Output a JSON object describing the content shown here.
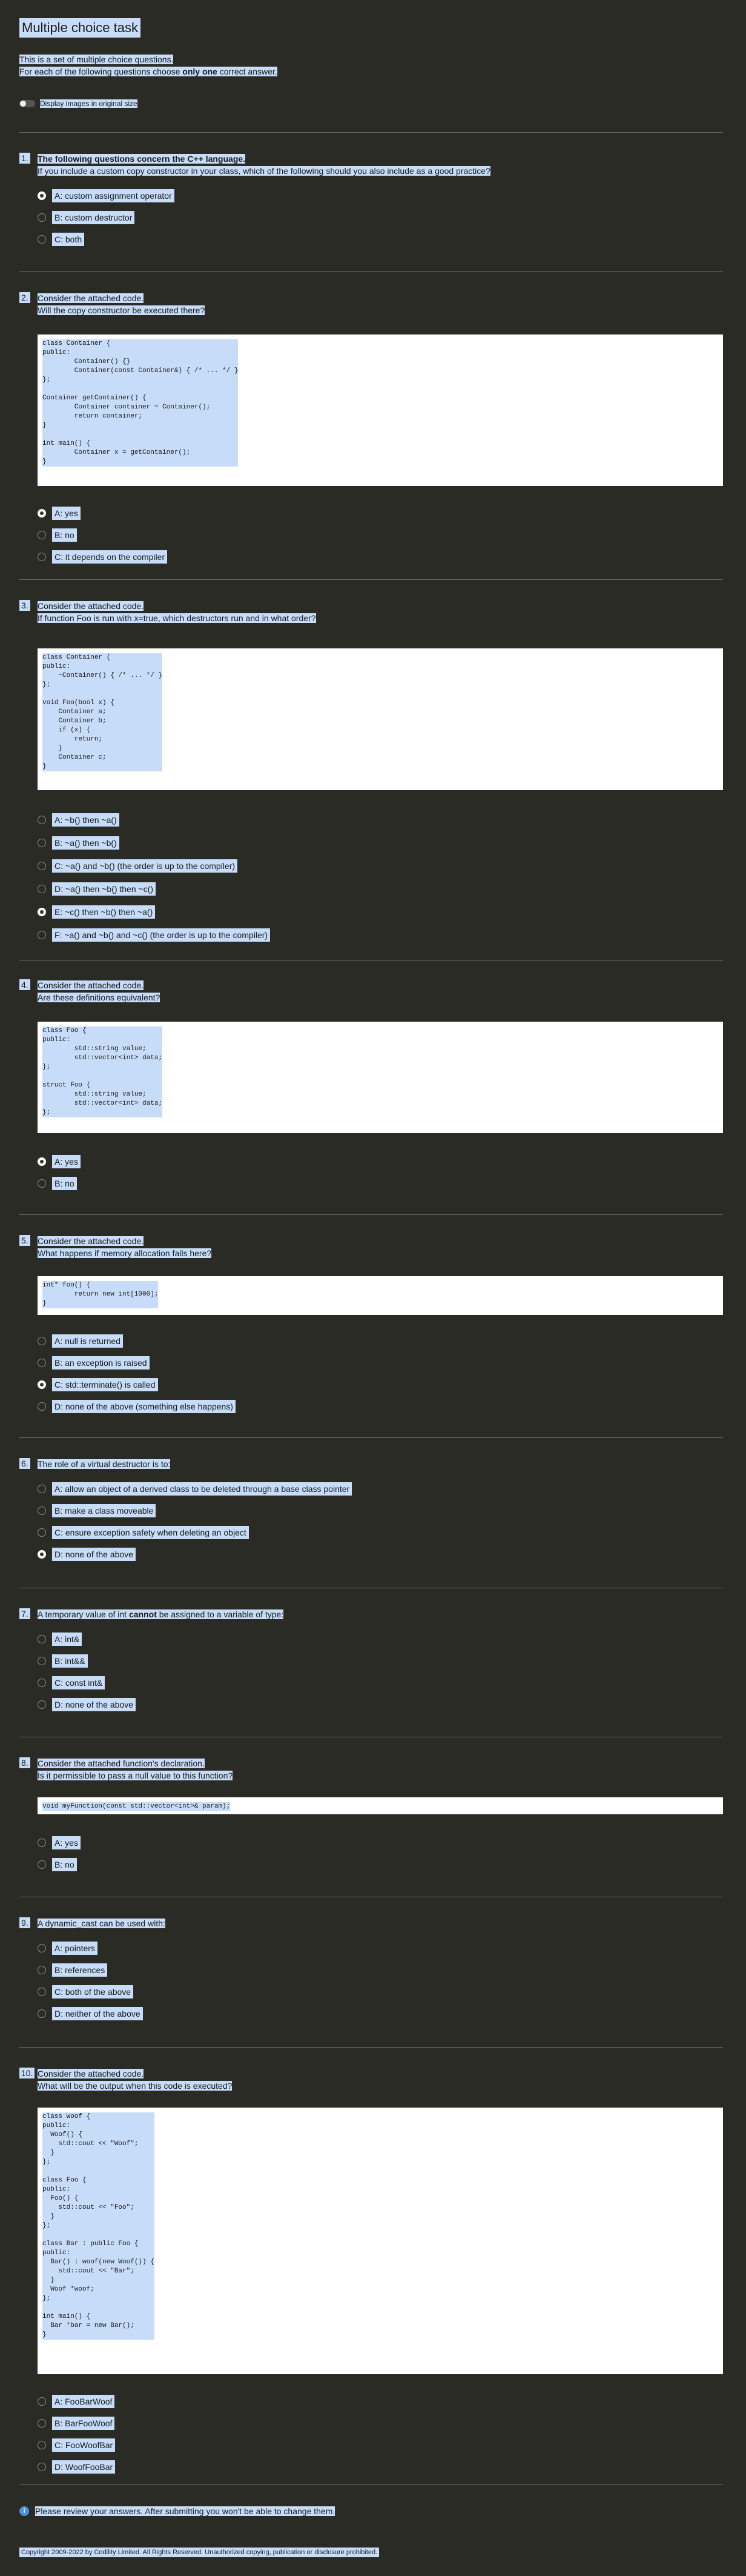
{
  "title": "Multiple choice task",
  "intro": {
    "line1": "This is a set of multiple choice questions.",
    "line2_pre": "For each of the following questions choose ",
    "line2_bold": "only one",
    "line2_post": " correct answer."
  },
  "toggle_label": "Display images in original size",
  "questions": [
    {
      "num": "1.",
      "line1": "The following questions concern the C++ language.",
      "line2": "If you include a custom copy constructor in your class, which of the following should you also include as a good practice?",
      "options": [
        "A: custom assignment operator",
        "B: custom destructor",
        "C: both"
      ],
      "selected": 0
    },
    {
      "num": "2.",
      "line1": "Consider the attached code.",
      "line2": "Will the copy constructor be executed there?",
      "code": "class Container {\npublic:\n        Container() {}\n        Container(const Container&) { /* ... */ }\n};\n\nContainer getContainer() {\n        Container container = Container();\n        return container;\n}\n\nint main() {\n        Container x = getContainer();\n}",
      "options": [
        "A: yes",
        "B: no",
        "C: it depends on the compiler"
      ],
      "selected": 0
    },
    {
      "num": "3.",
      "line1": "Consider the attached code.",
      "line2": "If function Foo is run with x=true, which destructors run and in what order?",
      "code": "class Container {\npublic:\n    ~Container() { /* ... */ }\n};\n\nvoid Foo(bool x) {\n    Container a;\n    Container b;\n    if (x) {\n        return;\n    }\n    Container c;\n}",
      "options": [
        "A: ~b() then ~a()",
        "B: ~a() then ~b()",
        "C: ~a() and ~b() (the order is up to the compiler)",
        "D: ~a() then ~b() then ~c()",
        "E: ~c() then ~b() then ~a()",
        "F: ~a() and ~b() and ~c() (the order is up to the compiler)"
      ],
      "selected": 4
    },
    {
      "num": "4.",
      "line1": "Consider the attached code.",
      "line2": "Are these definitions equivalent?",
      "code": "class Foo {\npublic:\n        std::string value;\n        std::vector<int> data;\n};\n\nstruct Foo {\n        std::string value;\n        std::vector<int> data;\n};",
      "options": [
        "A: yes",
        "B: no"
      ],
      "selected": 0
    },
    {
      "num": "5.",
      "line1": "Consider the attached code.",
      "line2": "What happens if memory allocation fails here?",
      "code": "int* foo() {\n        return new int[1000];\n}",
      "options": [
        "A: null is returned",
        "B: an exception is raised",
        "C: std::terminate() is called",
        "D: none of the above (something else happens)"
      ],
      "selected": 2
    },
    {
      "num": "6.",
      "line1": "The role of a virtual destructor is to:",
      "line2": "",
      "options": [
        "A: allow an object of a derived class to be deleted through a base class pointer",
        "B: make a class moveable",
        "C: ensure exception safety when deleting an object",
        "D: none of the above"
      ],
      "selected": 3
    },
    {
      "num": "7.",
      "line1_pre": "A temporary value of int ",
      "line1_bold": "cannot",
      "line1_post": " be assigned to a variable of type:",
      "line2": "",
      "options": [
        "A: int&",
        "B: int&&",
        "C: const int&",
        "D: none of the above"
      ],
      "selected": -1
    },
    {
      "num": "8.",
      "line1": "Consider the attached function's declaration.",
      "line2": "Is it permissible to pass a null value to this function?",
      "code": "void myFunction(const std::vector<int>& param);",
      "options": [
        "A: yes",
        "B: no"
      ],
      "selected": -1
    },
    {
      "num": "9.",
      "line1": "A dynamic_cast can be used with:",
      "line2": "",
      "options": [
        "A: pointers",
        "B: references",
        "C: both of the above",
        "D: neither of the above"
      ],
      "selected": -1
    },
    {
      "num": "10.",
      "line1": "Consider the attached code.",
      "line2": "What will be the output when this code is executed?",
      "code": "class Woof {\npublic:\n  Woof() {\n    std::cout << \"Woof\";\n  }\n};\n\nclass Foo {\npublic:\n  Foo() {\n    std::cout << \"Foo\";\n  }\n};\n\nclass Bar : public Foo {\npublic:\n  Bar() : woof(new Woof()) {\n    std::cout << \"Bar\";\n  }\n  Woof *woof;\n};\n\nint main() {\n  Bar *bar = new Bar();\n}",
      "options": [
        "A: FooBarWoof",
        "B: BarFooWoof",
        "C: FooWoofBar",
        "D: WoofFooBar"
      ],
      "selected": -1
    }
  ],
  "submit_note": "Please review your answers. After submitting you won't be able to change them.",
  "footer": "Copyright 2009-2022 by Codility Limited. All Rights Reserved. Unauthorized copying, publication or disclosure prohibited."
}
